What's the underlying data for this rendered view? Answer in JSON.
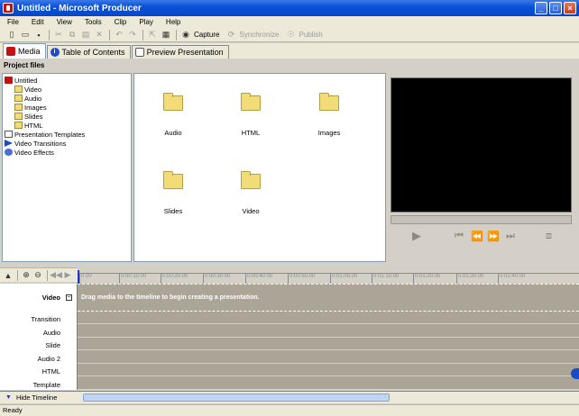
{
  "window": {
    "title": "Untitled - Microsoft Producer"
  },
  "menu": [
    "File",
    "Edit",
    "View",
    "Tools",
    "Clip",
    "Play",
    "Help"
  ],
  "toolbar": {
    "capture_label": "Capture",
    "synchronize_label": "Synchronize",
    "publish_label": "Publish"
  },
  "tabs": [
    {
      "label": "Media"
    },
    {
      "label": "Table of Contents"
    },
    {
      "label": "Preview Presentation"
    }
  ],
  "project_files": {
    "header": "Project files",
    "tree": [
      {
        "label": "Untitled"
      },
      {
        "label": "Video"
      },
      {
        "label": "Audio"
      },
      {
        "label": "Images"
      },
      {
        "label": "Slides"
      },
      {
        "label": "HTML"
      },
      {
        "label": "Presentation Templates"
      },
      {
        "label": "Video Transitions"
      },
      {
        "label": "Video Effects"
      }
    ]
  },
  "content_items": [
    {
      "label": "Audio"
    },
    {
      "label": "HTML"
    },
    {
      "label": "Images"
    },
    {
      "label": "Slides"
    },
    {
      "label": "Video"
    }
  ],
  "ruler_ticks": [
    "0.00",
    "0:00:10.00",
    "0:00:20.00",
    "0:00:30.00",
    "0:00:40.00",
    "0:00:50.00",
    "0:01:00.00",
    "0:01:10.00",
    "0:01:20.00",
    "0:01:30.00",
    "0:01:40.00"
  ],
  "timeline": {
    "tracks": [
      "Video",
      "Transition",
      "Audio",
      "Slide",
      "Audio 2",
      "HTML",
      "Template"
    ],
    "drag_message": "Drag media to the timeline to begin creating a presentation.",
    "hide_label": "Hide Timeline"
  },
  "status": {
    "text": "Ready"
  }
}
